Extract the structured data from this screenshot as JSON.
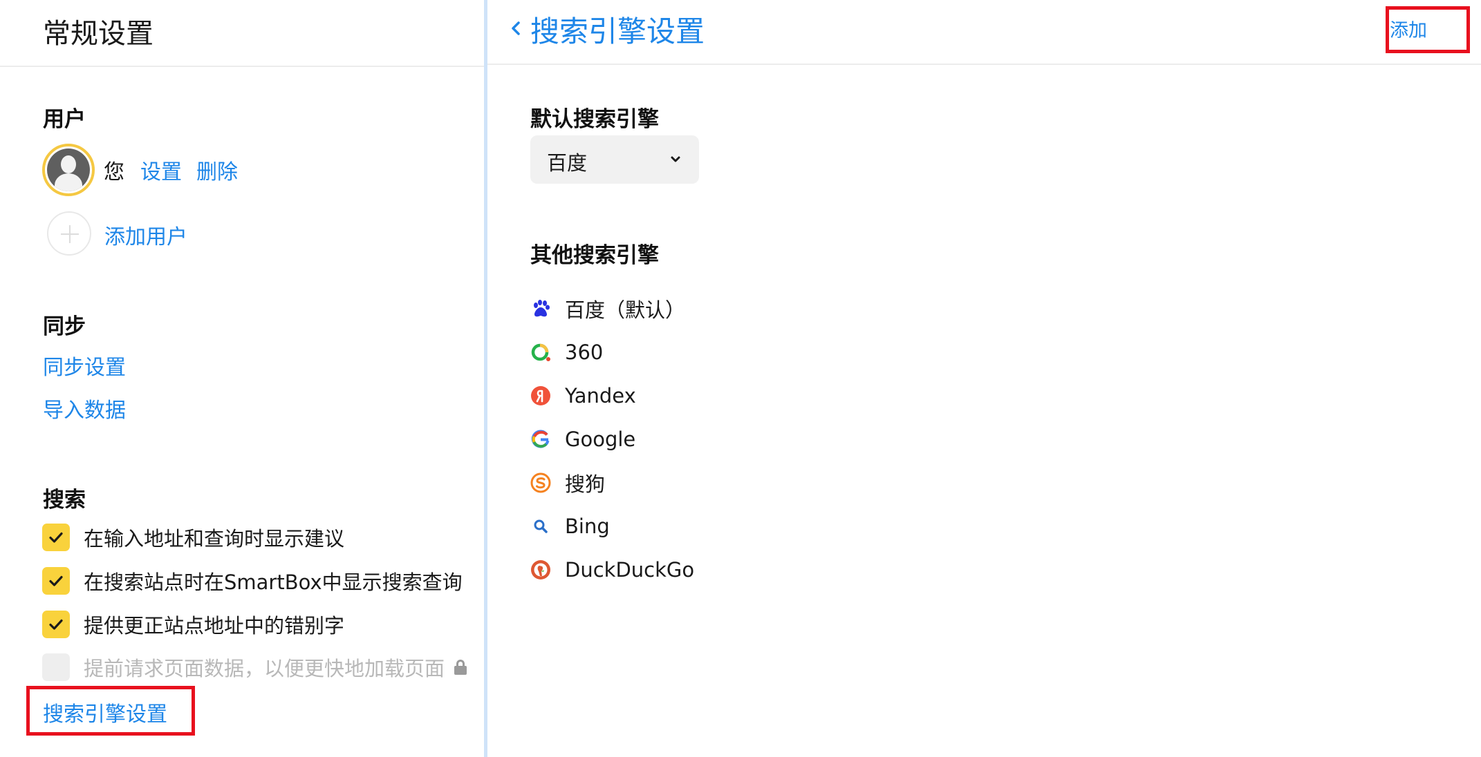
{
  "left": {
    "title": "常规设置",
    "user_section": {
      "heading": "用户",
      "user_name": "您",
      "settings_link": "设置",
      "delete_link": "删除",
      "add_user": "添加用户"
    },
    "sync_section": {
      "heading": "同步",
      "sync_settings": "同步设置",
      "import_data": "导入数据"
    },
    "search_section": {
      "heading": "搜索",
      "options": [
        {
          "label": "在输入地址和查询时显示建议",
          "checked": true,
          "disabled": false
        },
        {
          "label": "在搜索站点时在SmartBox中显示搜索查询",
          "checked": true,
          "disabled": false
        },
        {
          "label": "提供更正站点地址中的错别字",
          "checked": true,
          "disabled": false
        },
        {
          "label": "提前请求页面数据，以便更快地加载页面",
          "checked": false,
          "disabled": true
        }
      ],
      "engine_settings_link": "搜索引擎设置"
    }
  },
  "right": {
    "title": "搜索引擎设置",
    "add_label": "添加",
    "default_heading": "默认搜索引擎",
    "default_selected": "百度",
    "other_heading": "其他搜索引擎",
    "engines": [
      {
        "label": "百度（默认）",
        "icon": "baidu-icon"
      },
      {
        "label": "360",
        "icon": "360-icon"
      },
      {
        "label": "Yandex",
        "icon": "yandex-icon"
      },
      {
        "label": "Google",
        "icon": "google-icon"
      },
      {
        "label": "搜狗",
        "icon": "sogou-icon"
      },
      {
        "label": "Bing",
        "icon": "bing-icon"
      },
      {
        "label": "DuckDuckGo",
        "icon": "duckduckgo-icon"
      }
    ]
  },
  "colors": {
    "accent_link": "#1e86e8",
    "checkbox_checked": "#f9d23c",
    "highlight": "#e8101e"
  }
}
